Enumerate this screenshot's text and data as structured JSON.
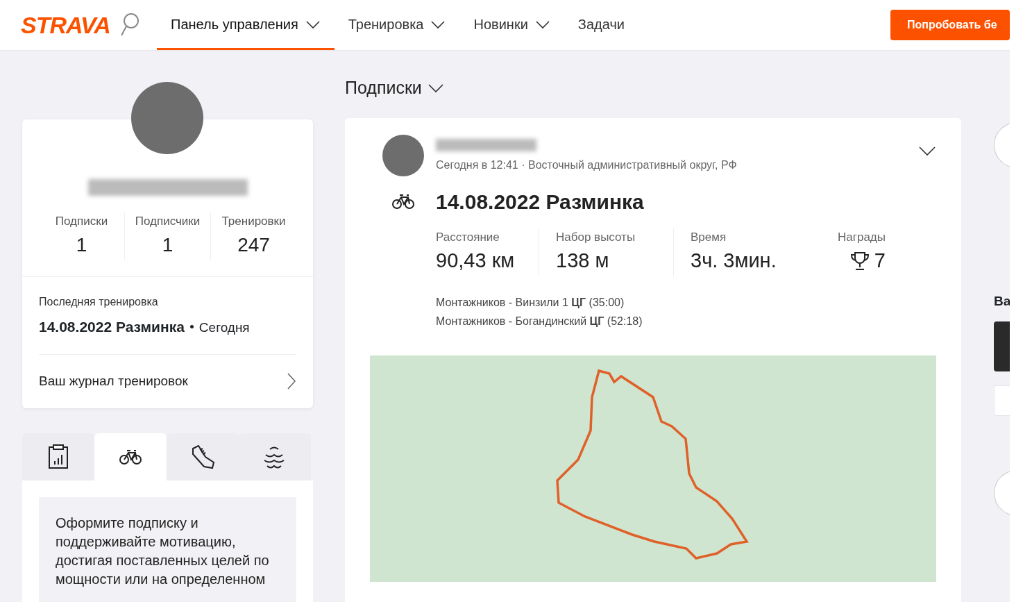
{
  "header": {
    "logo": "STRAVA",
    "nav": [
      {
        "label": "Панель управления",
        "selected": true,
        "has_dropdown": true
      },
      {
        "label": "Тренировка",
        "selected": false,
        "has_dropdown": true
      },
      {
        "label": "Новинки",
        "selected": false,
        "has_dropdown": true
      },
      {
        "label": "Задачи",
        "selected": false,
        "has_dropdown": false
      }
    ],
    "cta": "Попробовать бе"
  },
  "profile": {
    "stats": [
      {
        "label": "Подписки",
        "value": "1"
      },
      {
        "label": "Подписчики",
        "value": "1"
      },
      {
        "label": "Тренировки",
        "value": "247"
      }
    ],
    "last_workout": {
      "label": "Последняя тренировка",
      "title": "14.08.2022 Разминка",
      "date": "Сегодня"
    },
    "journal_link": "Ваш журнал тренировок"
  },
  "sport_tabs": [
    {
      "kind": "overview",
      "selected": false
    },
    {
      "kind": "ride",
      "selected": true
    },
    {
      "kind": "run",
      "selected": false
    },
    {
      "kind": "swim",
      "selected": false
    }
  ],
  "promo": {
    "text": "Оформите подписку и поддерживайте мотивацию, достигая поставленных целей по мощности или на определенном"
  },
  "feed": {
    "filter": "Подписки",
    "activity": {
      "meta": "Сегодня в 12:41 · Восточный административный округ, РФ",
      "title": "14.08.2022 Разминка",
      "stats": [
        {
          "label": "Расстояние",
          "value": "90,43 км"
        },
        {
          "label": "Набор высоты",
          "value": "138 м"
        },
        {
          "label": "Время",
          "value": "3ч. 3мин."
        }
      ],
      "awards": {
        "label": "Награды",
        "value": "7"
      },
      "segments": [
        "Монтажников - Винзили 1 **ЦГ** (35:00)",
        "Монтажников - Богандинский **ЦГ** (52:18)"
      ]
    }
  },
  "right": {
    "heading": "Ва"
  }
}
